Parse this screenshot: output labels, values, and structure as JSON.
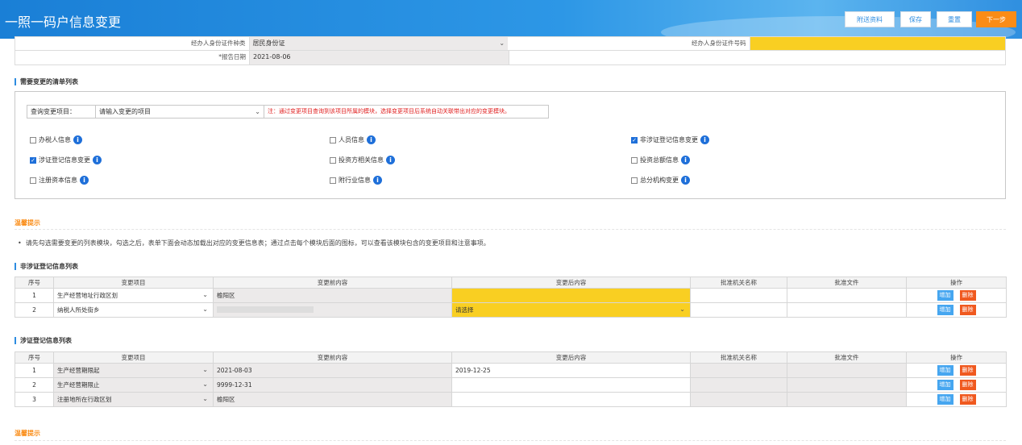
{
  "header": {
    "title": "一照一码户信息变更",
    "buttons": {
      "attach": "附送资料",
      "save": "保存",
      "reset": "重置",
      "next": "下一步"
    }
  },
  "top_form": {
    "row1": {
      "label": "经办人身份证件种类",
      "value": "居民身份证",
      "label2": "经办人身份证件号码",
      "value2": ""
    },
    "row2": {
      "label": "*报告日期",
      "value": "2021-08-06"
    }
  },
  "checklist": {
    "section_title": "需要变更的清单列表",
    "query_label": "查询变更项目：",
    "query_placeholder": "请输入变更的项目",
    "query_note": "注：通过变更项目查询到该项目所属的模块，选择变更项目后系统自动关联带出对应的变更模块。",
    "items": [
      {
        "label": "办税人信息",
        "checked": false
      },
      {
        "label": "人员信息",
        "checked": false
      },
      {
        "label": "非涉证登记信息变更",
        "checked": true
      },
      {
        "label": "涉证登记信息变更",
        "checked": true
      },
      {
        "label": "投资方相关信息",
        "checked": false
      },
      {
        "label": "投资总额信息",
        "checked": false
      },
      {
        "label": "注册资本信息",
        "checked": false
      },
      {
        "label": "附行业信息",
        "checked": false
      },
      {
        "label": "总分机构变更",
        "checked": false
      }
    ]
  },
  "tip": {
    "title": "温馨提示",
    "text": "请先勾选需要变更的列表模块，勾选之后，表单下面会动态加载出对应的变更信息表；通过点击每个模块后面的图标，可以查看该模块包含的变更项目和注意事项。"
  },
  "table1": {
    "title": "非涉证登记信息列表",
    "headers": [
      "序号",
      "变更项目",
      "变更前内容",
      "变更后内容",
      "批准机关名称",
      "批准文件",
      "操作"
    ],
    "rows": [
      {
        "no": "1",
        "item": "生产经营地址行政区划",
        "before": "榆阳区",
        "after": ""
      },
      {
        "no": "2",
        "item": "纳税人所处街乡",
        "before": "",
        "after": "请选择"
      }
    ]
  },
  "table2": {
    "title": "涉证登记信息列表",
    "headers": [
      "序号",
      "变更项目",
      "变更前内容",
      "变更后内容",
      "批准机关名称",
      "批准文件",
      "操作"
    ],
    "rows": [
      {
        "no": "1",
        "item": "生产经营期限起",
        "before": "2021-08-03",
        "after": "2019-12-25"
      },
      {
        "no": "2",
        "item": "生产经营期限止",
        "before": "9999-12-31",
        "after": ""
      },
      {
        "no": "3",
        "item": "注册地所在行政区划",
        "before": "榆阳区",
        "after": ""
      }
    ]
  },
  "ops": {
    "add": "增加",
    "delete": "删除"
  },
  "tip2": {
    "title": "温馨提示"
  },
  "colors": {
    "header": "#2d8ce0",
    "accent_orange": "#fa8c16",
    "highlight_yellow": "#f9cf22",
    "delete_red": "#f0591f",
    "add_blue": "#46a6f0"
  }
}
